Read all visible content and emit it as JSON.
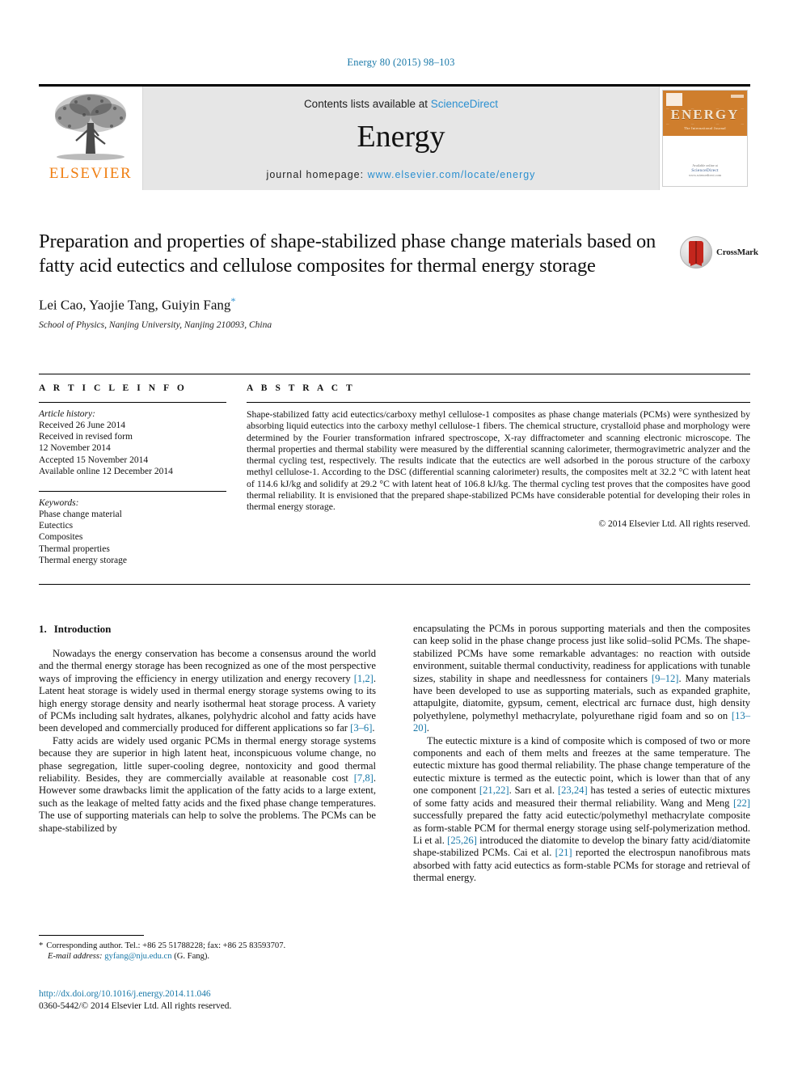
{
  "running_head": "Energy 80 (2015) 98–103",
  "masthead": {
    "publisher_logo_label": "ELSEVIER",
    "contents_prefix": "Contents lists available at ",
    "contents_link": "ScienceDirect",
    "journal_title": "Energy",
    "homepage_prefix": "journal homepage: ",
    "homepage_url": "www.elsevier.com/locate/energy",
    "cover": {
      "title": "ENERGY",
      "subtitle": "The International Journal",
      "footer_small": "Available online at",
      "footer_brand": "ScienceDirect",
      "footer_url": "www.sciencedirect.com"
    }
  },
  "article": {
    "title": "Preparation and properties of shape-stabilized phase change materials based on fatty acid eutectics and cellulose composites for thermal energy storage",
    "authors": "Lei Cao, Yaojie Tang, Guiyin Fang",
    "corresponding_marker": "*",
    "affiliation": "School of Physics, Nanjing University, Nanjing 210093, China",
    "crossmark_label": "CrossMark"
  },
  "article_info": {
    "heading": "A R T I C L E  I N F O",
    "history_label": "Article history:",
    "history": [
      "Received 26 June 2014",
      "Received in revised form",
      "12 November 2014",
      "Accepted 15 November 2014",
      "Available online 12 December 2014"
    ],
    "keywords_label": "Keywords:",
    "keywords": [
      "Phase change material",
      "Eutectics",
      "Composites",
      "Thermal properties",
      "Thermal energy storage"
    ]
  },
  "abstract": {
    "heading": "A B S T R A C T",
    "text": "Shape-stabilized fatty acid eutectics/carboxy methyl cellulose-1 composites as phase change materials (PCMs) were synthesized by absorbing liquid eutectics into the carboxy methyl cellulose-1 fibers. The chemical structure, crystalloid phase and morphology were determined by the Fourier transformation infrared spectroscope, X-ray diffractometer and scanning electronic microscope. The thermal properties and thermal stability were measured by the differential scanning calorimeter, thermogravimetric analyzer and the thermal cycling test, respectively. The results indicate that the eutectics are well adsorbed in the porous structure of the carboxy methyl cellulose-1. According to the DSC (differential scanning calorimeter) results, the composites melt at 32.2 °C with latent heat of 114.6 kJ/kg and solidify at 29.2 °C with latent heat of 106.8 kJ/kg. The thermal cycling test proves that the composites have good thermal reliability. It is envisioned that the prepared shape-stabilized PCMs have considerable potential for developing their roles in thermal energy storage.",
    "copyright": "© 2014 Elsevier Ltd. All rights reserved."
  },
  "sections": {
    "intro_number": "1.",
    "intro_title": "Introduction"
  },
  "body_left": {
    "p1_a": "Nowadays the energy conservation has become a consensus around the world and the thermal energy storage has been recognized as one of the most perspective ways of improving the efficiency in energy utilization and energy recovery ",
    "p1_ref1": "[1,2]",
    "p1_b": ". Latent heat storage is widely used in thermal energy storage systems owing to its high energy storage density and nearly isothermal heat storage process. A variety of PCMs including salt hydrates, alkanes, polyhydric alcohol and fatty acids have been developed and commercially produced for different applications so far ",
    "p1_ref2": "[3–6]",
    "p1_c": ".",
    "p2_a": "Fatty acids are widely used organic PCMs in thermal energy storage systems because they are superior in high latent heat, inconspicuous volume change, no phase segregation, little super-cooling degree, nontoxicity and good thermal reliability. Besides, they are commercially available at reasonable cost ",
    "p2_ref1": "[7,8]",
    "p2_b": ". However some drawbacks limit the application of the fatty acids to a large extent, such as the leakage of melted fatty acids and the fixed phase change temperatures. The use of supporting materials can help to solve the problems. The PCMs can be shape-stabilized by"
  },
  "body_right": {
    "p1_a": "encapsulating the PCMs in porous supporting materials and then the composites can keep solid in the phase change process just like solid–solid PCMs. The shape-stabilized PCMs have some remarkable advantages: no reaction with outside environment, suitable thermal conductivity, readiness for applications with tunable sizes, stability in shape and needlessness for containers ",
    "p1_ref1": "[9–12]",
    "p1_b": ". Many materials have been developed to use as supporting materials, such as expanded graphite, attapulgite, diatomite, gypsum, cement, electrical arc furnace dust, high density polyethylene, polymethyl methacrylate, polyurethane rigid foam and so on ",
    "p1_ref2": "[13–20]",
    "p1_c": ".",
    "p2_a": "The eutectic mixture is a kind of composite which is composed of two or more components and each of them melts and freezes at the same temperature. The eutectic mixture has good thermal reliability. The phase change temperature of the eutectic mixture is termed as the eutectic point, which is lower than that of any one component ",
    "p2_ref1": "[21,22]",
    "p2_b": ". Sarı et al. ",
    "p2_ref2": "[23,24]",
    "p2_c": " has tested a series of eutectic mixtures of some fatty acids and measured their thermal reliability. Wang and Meng ",
    "p2_ref3": "[22]",
    "p2_d": " successfully prepared the fatty acid eutectic/polymethyl methacrylate composite as form-stable PCM for thermal energy storage using self-polymerization method. Li et al. ",
    "p2_ref4": "[25,26]",
    "p2_e": " introduced the diatomite to develop the binary fatty acid/diatomite shape-stabilized PCMs. Cai et al. ",
    "p2_ref5": "[21]",
    "p2_f": " reported the electrospun nanofibrous mats absorbed with fatty acid eutectics as form-stable PCMs for storage and retrieval of thermal energy."
  },
  "footnote": {
    "bullet": "*",
    "corresponding": "Corresponding author. Tel.: +86 25 51788228; fax: +86 25 83593707.",
    "email_label": "E-mail address:",
    "email": "gyfang@nju.edu.cn",
    "email_suffix": "(G. Fang)."
  },
  "footer": {
    "doi": "http://dx.doi.org/10.1016/j.energy.2014.11.046",
    "issn": "0360-5442/© 2014 Elsevier Ltd. All rights reserved."
  }
}
